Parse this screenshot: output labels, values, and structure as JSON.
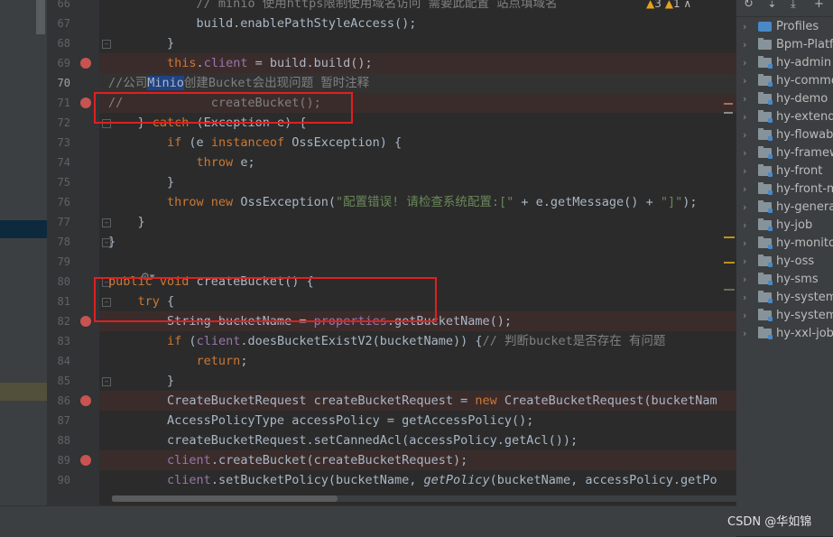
{
  "editor": {
    "lines": [
      {
        "num": "66",
        "segments": [
          {
            "t": "            ",
            "c": ""
          },
          {
            "t": "// minio 使用https限制使用域名访问 需要此配置 站点填域名",
            "c": "cm"
          }
        ]
      },
      {
        "num": "67",
        "segments": [
          {
            "t": "            build.enablePathStyleAccess();",
            "c": ""
          }
        ]
      },
      {
        "num": "68",
        "segments": [
          {
            "t": "        }",
            "c": ""
          }
        ]
      },
      {
        "num": "69",
        "segments": [
          {
            "t": "        ",
            "c": ""
          },
          {
            "t": "this",
            "c": "kw"
          },
          {
            "t": ".",
            "c": ""
          },
          {
            "t": "client",
            "c": "fd"
          },
          {
            "t": " = build.build();",
            "c": ""
          }
        ]
      },
      {
        "num": "70",
        "segments": [
          {
            "t": "//公司",
            "c": "cm"
          },
          {
            "t": "Minio",
            "c": "hlw"
          },
          {
            "t": "创建Bucket会出现问题 暂时注释",
            "c": "cm"
          }
        ]
      },
      {
        "num": "71",
        "segments": [
          {
            "t": "//            createBucket();",
            "c": "cm"
          }
        ]
      },
      {
        "num": "72",
        "segments": [
          {
            "t": "    } ",
            "c": ""
          },
          {
            "t": "catch",
            "c": "kw"
          },
          {
            "t": " (Exception e) {",
            "c": ""
          }
        ]
      },
      {
        "num": "73",
        "segments": [
          {
            "t": "        ",
            "c": ""
          },
          {
            "t": "if",
            "c": "kw"
          },
          {
            "t": " (e ",
            "c": ""
          },
          {
            "t": "instanceof",
            "c": "kw"
          },
          {
            "t": " OssException) {",
            "c": ""
          }
        ]
      },
      {
        "num": "74",
        "segments": [
          {
            "t": "            ",
            "c": ""
          },
          {
            "t": "throw",
            "c": "kw"
          },
          {
            "t": " e;",
            "c": ""
          }
        ]
      },
      {
        "num": "75",
        "segments": [
          {
            "t": "        }",
            "c": ""
          }
        ]
      },
      {
        "num": "76",
        "segments": [
          {
            "t": "        ",
            "c": ""
          },
          {
            "t": "throw new",
            "c": "kw"
          },
          {
            "t": " OssException(",
            "c": ""
          },
          {
            "t": "\"配置错误! 请检查系统配置:[\"",
            "c": "str"
          },
          {
            "t": " + e.getMessage() + ",
            "c": ""
          },
          {
            "t": "\"]\"",
            "c": "str"
          },
          {
            "t": ");",
            "c": ""
          }
        ]
      },
      {
        "num": "77",
        "segments": [
          {
            "t": "    }",
            "c": ""
          }
        ]
      },
      {
        "num": "78",
        "segments": [
          {
            "t": "}",
            "c": ""
          }
        ]
      },
      {
        "num": "79",
        "segments": [
          {
            "t": "",
            "c": ""
          }
        ]
      },
      {
        "num": "80",
        "segments": [
          {
            "t": "public void",
            "c": "kw"
          },
          {
            "t": " createBucket() {",
            "c": ""
          }
        ]
      },
      {
        "num": "81",
        "segments": [
          {
            "t": "    ",
            "c": ""
          },
          {
            "t": "try",
            "c": "kw"
          },
          {
            "t": " {",
            "c": ""
          }
        ]
      },
      {
        "num": "82",
        "segments": [
          {
            "t": "        String bucketName = ",
            "c": ""
          },
          {
            "t": "properties",
            "c": "fd"
          },
          {
            "t": ".getBucketName();",
            "c": ""
          }
        ]
      },
      {
        "num": "83",
        "segments": [
          {
            "t": "        ",
            "c": ""
          },
          {
            "t": "if",
            "c": "kw"
          },
          {
            "t": " (",
            "c": ""
          },
          {
            "t": "client",
            "c": "fd"
          },
          {
            "t": ".doesBucketExistV2(bucketName)) {",
            "c": ""
          },
          {
            "t": "// 判断bucket是否存在 有问题",
            "c": "cm"
          }
        ]
      },
      {
        "num": "84",
        "segments": [
          {
            "t": "            ",
            "c": ""
          },
          {
            "t": "return",
            "c": "kw"
          },
          {
            "t": ";",
            "c": ""
          }
        ]
      },
      {
        "num": "85",
        "segments": [
          {
            "t": "        }",
            "c": ""
          }
        ]
      },
      {
        "num": "86",
        "segments": [
          {
            "t": "        CreateBucketRequest createBucketRequest = ",
            "c": ""
          },
          {
            "t": "new",
            "c": "kw"
          },
          {
            "t": " CreateBucketRequest(bucketNam",
            "c": ""
          }
        ]
      },
      {
        "num": "87",
        "segments": [
          {
            "t": "        AccessPolicyType accessPolicy = getAccessPolicy();",
            "c": ""
          }
        ]
      },
      {
        "num": "88",
        "segments": [
          {
            "t": "        createBucketRequest.setCannedAcl(accessPolicy.getAcl());",
            "c": ""
          }
        ]
      },
      {
        "num": "89",
        "segments": [
          {
            "t": "        ",
            "c": ""
          },
          {
            "t": "client",
            "c": "fd"
          },
          {
            "t": ".createBucket(createBucketRequest);",
            "c": ""
          }
        ]
      },
      {
        "num": "90",
        "segments": [
          {
            "t": "        ",
            "c": ""
          },
          {
            "t": "client",
            "c": "fd"
          },
          {
            "t": ".setBucketPolicy(bucketName, ",
            "c": ""
          },
          {
            "t": "getPolicy",
            "c": "it"
          },
          {
            "t": "(bucketName, accessPolicy.getPo",
            "c": ""
          }
        ]
      }
    ],
    "breakpoint_lines": [
      "69",
      "71",
      "82",
      "86",
      "89"
    ],
    "current_line": "70",
    "inspection": {
      "warnings": "3",
      "weak_warnings": "1"
    }
  },
  "project_tree": {
    "items": [
      {
        "label": "Profiles",
        "kind": "profiles"
      },
      {
        "label": "Bpm-Platfo",
        "kind": "folder"
      },
      {
        "label": "hy-admin",
        "kind": "module"
      },
      {
        "label": "hy-commo",
        "kind": "module"
      },
      {
        "label": "hy-demo",
        "kind": "module"
      },
      {
        "label": "hy-extend",
        "kind": "module"
      },
      {
        "label": "hy-flowable",
        "kind": "module"
      },
      {
        "label": "hy-framewo",
        "kind": "module"
      },
      {
        "label": "hy-front",
        "kind": "module"
      },
      {
        "label": "hy-front-m",
        "kind": "module"
      },
      {
        "label": "hy-generat",
        "kind": "module"
      },
      {
        "label": "hy-job",
        "kind": "module"
      },
      {
        "label": "hy-monitor",
        "kind": "module"
      },
      {
        "label": "hy-oss",
        "kind": "module"
      },
      {
        "label": "hy-sms",
        "kind": "module"
      },
      {
        "label": "hy-system",
        "kind": "module"
      },
      {
        "label": "hy-system-",
        "kind": "module"
      },
      {
        "label": "hy-xxl-job-",
        "kind": "module"
      }
    ]
  },
  "watermark": "CSDN @华如锦",
  "colors": {
    "breakpoint": "#c75450",
    "annotation_box": "#e02020",
    "keyword": "#cc7832",
    "field": "#9876aa",
    "string": "#6a8759",
    "comment": "#808080"
  }
}
